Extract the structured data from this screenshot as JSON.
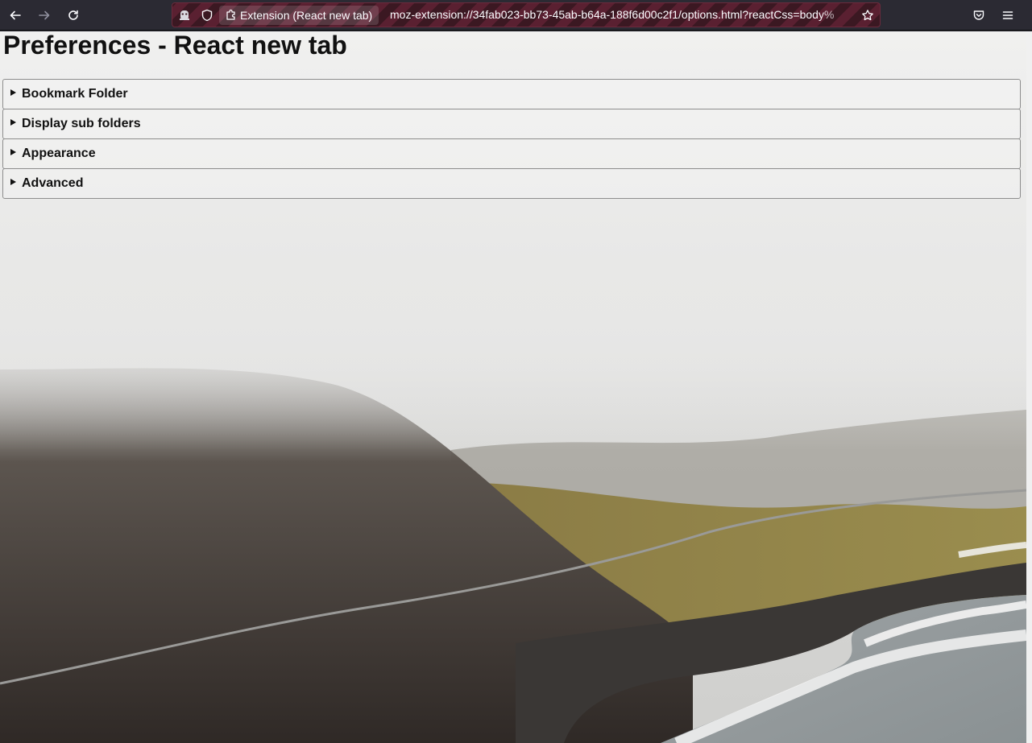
{
  "browser": {
    "tab_identity_label": "Extension (React new tab)",
    "url": "moz-extension://34fab023-bb73-45ab-b64a-188f6d00c2f1/options.html?reactCss=body%",
    "icons": [
      "back-icon",
      "forward-icon",
      "reload-icon",
      "private-mask-icon",
      "tracking-shield-icon",
      "extension-puzzle-icon",
      "bookmark-star-icon",
      "pocket-icon",
      "menu-icon"
    ]
  },
  "page": {
    "title": "Preferences - React new tab",
    "sections": [
      {
        "label": "Bookmark Folder"
      },
      {
        "label": "Display sub folders"
      },
      {
        "label": "Appearance"
      },
      {
        "label": "Advanced"
      }
    ]
  },
  "colors": {
    "toolbar_bg": "#2b2a33",
    "private_url_stripe_a": "#3b1822",
    "private_url_stripe_b": "#5a2031"
  }
}
